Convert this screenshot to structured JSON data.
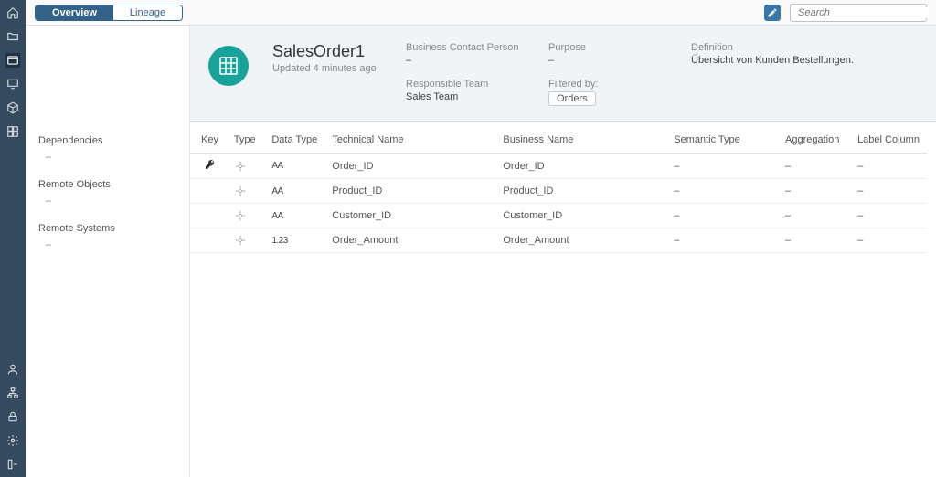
{
  "tabs": {
    "overview": "Overview",
    "lineage": "Lineage"
  },
  "search": {
    "placeholder": "Search"
  },
  "object": {
    "title": "SalesOrder1",
    "subtitle": "Updated 4 minutes ago"
  },
  "meta": {
    "contact_label": "Business Contact Person",
    "contact_value": "–",
    "team_label": "Responsible Team",
    "team_value": "Sales Team",
    "purpose_label": "Purpose",
    "purpose_value": "–",
    "filtered_label": "Filtered by:",
    "filtered_chip": "Orders",
    "definition_label": "Definition",
    "definition_value": "Übersicht von Kunden Bestellungen."
  },
  "side": {
    "deps_label": "Dependencies",
    "deps_value": "–",
    "remote_obj_label": "Remote Objects",
    "remote_obj_value": "–",
    "remote_sys_label": "Remote Systems",
    "remote_sys_value": "–"
  },
  "table": {
    "headers": {
      "key": "Key",
      "type": "Type",
      "datatype": "Data Type",
      "techname": "Technical Name",
      "bizname": "Business Name",
      "semtype": "Semantic Type",
      "aggregation": "Aggregation",
      "labelcol": "Label Column"
    },
    "rows": [
      {
        "key": true,
        "datatype": "AA",
        "tech": "Order_ID",
        "biz": "Order_ID",
        "sem": "–",
        "agg": "–",
        "lab": "–"
      },
      {
        "key": false,
        "datatype": "AA",
        "tech": "Product_ID",
        "biz": "Product_ID",
        "sem": "–",
        "agg": "–",
        "lab": "–"
      },
      {
        "key": false,
        "datatype": "AA",
        "tech": "Customer_ID",
        "biz": "Customer_ID",
        "sem": "–",
        "agg": "–",
        "lab": "–"
      },
      {
        "key": false,
        "datatype": "1.23",
        "tech": "Order_Amount",
        "biz": "Order_Amount",
        "sem": "–",
        "agg": "–",
        "lab": "–"
      }
    ]
  }
}
